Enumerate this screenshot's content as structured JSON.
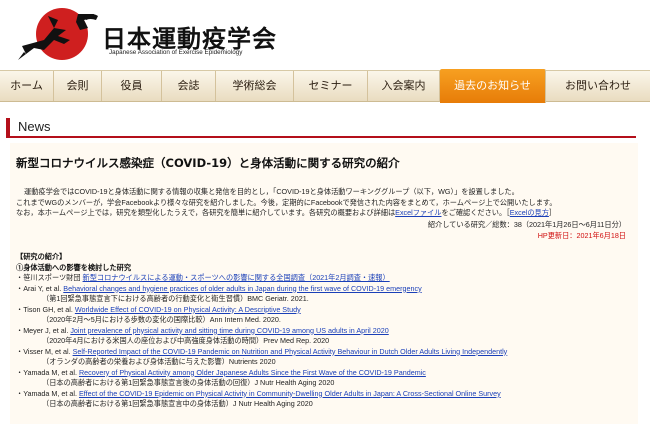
{
  "brand": {
    "title": "日本運動疫学会",
    "subtitle": "Japanese Association of Exercise Epidemiology"
  },
  "nav": [
    {
      "label": "ホーム",
      "active": false
    },
    {
      "label": "会則",
      "active": false
    },
    {
      "label": "役員",
      "active": false
    },
    {
      "label": "会誌",
      "active": false
    },
    {
      "label": "学術総会",
      "active": false
    },
    {
      "label": "セミナー",
      "active": false
    },
    {
      "label": "入会案内",
      "active": false
    },
    {
      "label": "過去のお知らせ",
      "active": true
    },
    {
      "label": "お問い合わせ",
      "active": false
    }
  ],
  "section_title": "News",
  "article": {
    "title": "新型コロナウイルス感染症（COVID-19）と身体活動に関する研究の紹介",
    "intro": [
      "運動疫学会ではCOVID-19と身体活動に関する情報の収集と発信を目的とし，「COVID-19と身体活動ワーキンググループ（以下，WG）」を設置しました。",
      "これまでWGのメンバーが，学会Facebookより様々な研究を紹介しました。今後，定期的にFacebookで発信された内容をまとめて，ホームページ上で公開いたします。"
    ],
    "intro3_pre": "なお，本ホームページ上では，研究を類型化したうえで，各研究を簡単に紹介しています。各研究の概要および詳細は",
    "intro3_link": "Excelファイル",
    "intro3_mid": "をご確認ください。［",
    "intro3_link2": "Excelの見方",
    "intro3_post": "］",
    "meta_count": "紹介している研究／総数：38（2021年1月26日〜6月11日分）",
    "meta_updated": "HP更新日：2021年6月18日",
    "section_label": "【研究の紹介】",
    "subsection_label": "①身体活動への影響を検討した研究",
    "entries": [
      {
        "author": "・笹川スポーツ財団 ",
        "link": "新型コロナウイルスによる運動・スポーツへの影響に関する全国調査（2021年2月調査・速報）",
        "note": ""
      },
      {
        "author": "・Arai Y, et al. ",
        "link": "Behavioral changes and hygiene practices of older adults in Japan during the first wave of COVID-19 emergency",
        "note": "（第1回緊急事態宣言下における高齢者の行動変化と衛生習慣）BMC Geriatr. 2021."
      },
      {
        "author": "・Tison GH, et al. ",
        "link": "Worldwide Effect of COVID-19 on Physical Activity: A Descriptive Study",
        "note": "（2020年2月〜5月における歩数の変化の国際比較）Ann Intern Med. 2020."
      },
      {
        "author": "・Meyer J, et al. ",
        "link": "Joint prevalence of physical activity and sitting time during COVID-19 among US adults in April 2020",
        "note": "（2020年4月における米国人の座位および中高強度身体活動の時間）Prev Med Rep. 2020"
      },
      {
        "author": "・Visser M, et al. ",
        "link": "Self-Reported Impact of the COVID-19 Pandemic on Nutrition and Physical Activity Behaviour in Dutch Older Adults Living Independently",
        "note": "（オランダの高齢者の栄養および身体活動に与えた影響）Nutrients 2020"
      },
      {
        "author": "・Yamada M, et al. ",
        "link": "Recovery of Physical Activity among Older Japanese Adults Since the First Wave of the COVID-19 Pandemic",
        "note": "（日本の高齢者における第1回緊急事態宣言後の身体活動の回復）J Nutr Health Aging 2020"
      },
      {
        "author": "・Yamada M, et al. ",
        "link": "Effect of the COVID-19 Epidemic on Physical Activity in Community-Dwelling Older Adults in Japan: A Cross-Sectional Online Survey",
        "note": "（日本の高齢者における第1回緊急事態宣言中の身体活動）J Nutr Health Aging 2020"
      }
    ]
  }
}
